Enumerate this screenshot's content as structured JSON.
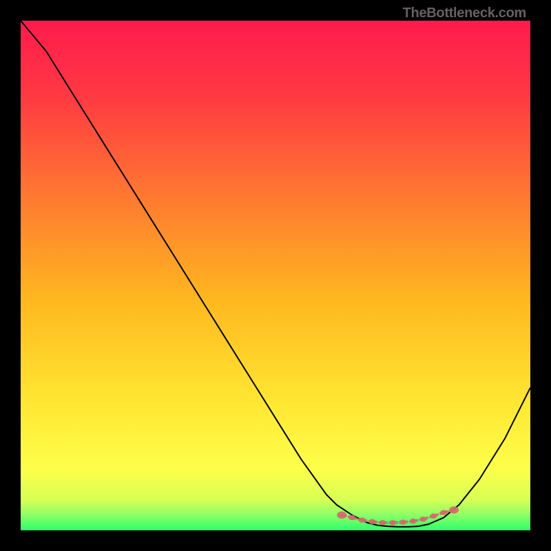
{
  "watermark": "TheBottleneck.com",
  "chart_data": {
    "type": "line",
    "title": "",
    "xlabel": "",
    "ylabel": "",
    "xlim": [
      0,
      100
    ],
    "ylim": [
      0,
      100
    ],
    "series": [
      {
        "name": "curve",
        "color": "#000000",
        "x": [
          0,
          5,
          10,
          15,
          20,
          25,
          30,
          35,
          40,
          45,
          50,
          55,
          60,
          62,
          65,
          68,
          70,
          72,
          74,
          76,
          78,
          80,
          83,
          86,
          90,
          95,
          100
        ],
        "y": [
          100,
          94,
          86,
          78,
          70,
          62,
          54,
          46,
          38,
          30,
          22,
          14,
          7,
          5,
          3,
          1.5,
          1,
          0.8,
          0.7,
          0.7,
          0.8,
          1.2,
          2.5,
          5,
          10,
          18,
          28
        ]
      },
      {
        "name": "optimal-band",
        "color": "#d5696b",
        "type": "marker-band",
        "x": [
          63,
          65,
          67,
          69,
          71,
          73,
          75,
          77,
          79,
          81,
          83,
          85
        ],
        "y": [
          3,
          2.5,
          2,
          1.7,
          1.5,
          1.5,
          1.6,
          1.8,
          2.2,
          2.8,
          3.5,
          4
        ]
      }
    ],
    "background_gradient": {
      "stops": [
        {
          "offset": 0.0,
          "color": "#ff1a4d"
        },
        {
          "offset": 0.15,
          "color": "#ff3a42"
        },
        {
          "offset": 0.35,
          "color": "#ff7a30"
        },
        {
          "offset": 0.55,
          "color": "#ffb81f"
        },
        {
          "offset": 0.75,
          "color": "#ffe733"
        },
        {
          "offset": 0.88,
          "color": "#fdff4a"
        },
        {
          "offset": 0.94,
          "color": "#d8ff55"
        },
        {
          "offset": 0.97,
          "color": "#8cff67"
        },
        {
          "offset": 1.0,
          "color": "#2bff6a"
        }
      ]
    }
  }
}
